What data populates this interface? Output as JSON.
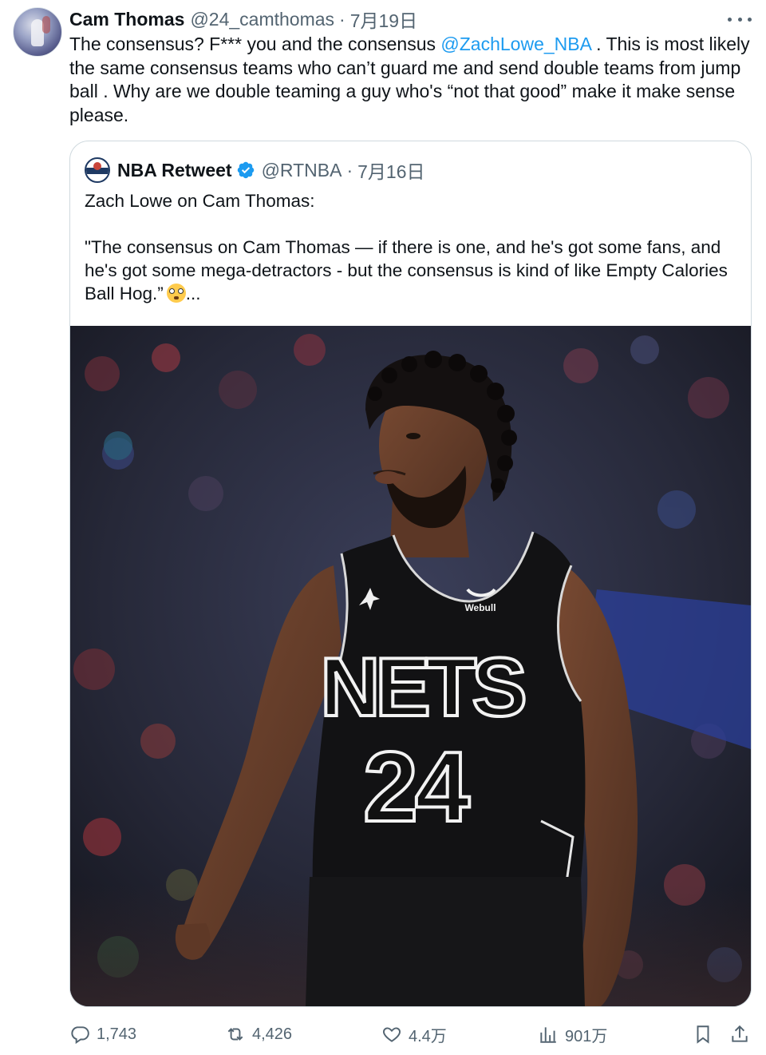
{
  "tweet": {
    "author": {
      "display_name": "Cam Thomas",
      "handle": "@24_camthomas",
      "date": "7月19日"
    },
    "text_before_mention": "The consensus? F*** you and the consensus ",
    "mention": "@ZachLowe_NBA",
    "text_after_mention": " . This is most likely the same consensus teams who can’t guard me and send double teams from jump ball . Why are we double teaming a guy who's “not that good” make it make sense please.",
    "more_icon": "more-horizontal-icon"
  },
  "quote": {
    "author": {
      "display_name": "NBA Retweet",
      "handle": "@RTNBA",
      "date": "7月16日",
      "verified": true
    },
    "line1": "Zach Lowe on Cam Thomas:",
    "line2": "\"The consensus on Cam Thomas — if there is one, and he's got some fans, and he's got some mega-detractors - but the consensus is kind of like Empty Calories Ball Hog.”",
    "ellipsis": "...",
    "emoji": "flushed-face",
    "media": {
      "jersey_team": "NETS",
      "jersey_number": "24",
      "jersey_sponsor": "Webull"
    }
  },
  "actions": {
    "replies": "1,743",
    "retweets": "4,426",
    "likes": "4.4万",
    "views": "901万"
  },
  "colors": {
    "text": "#0f1419",
    "secondary": "#536471",
    "link": "#1d9bf0",
    "border": "#cfd9de"
  }
}
